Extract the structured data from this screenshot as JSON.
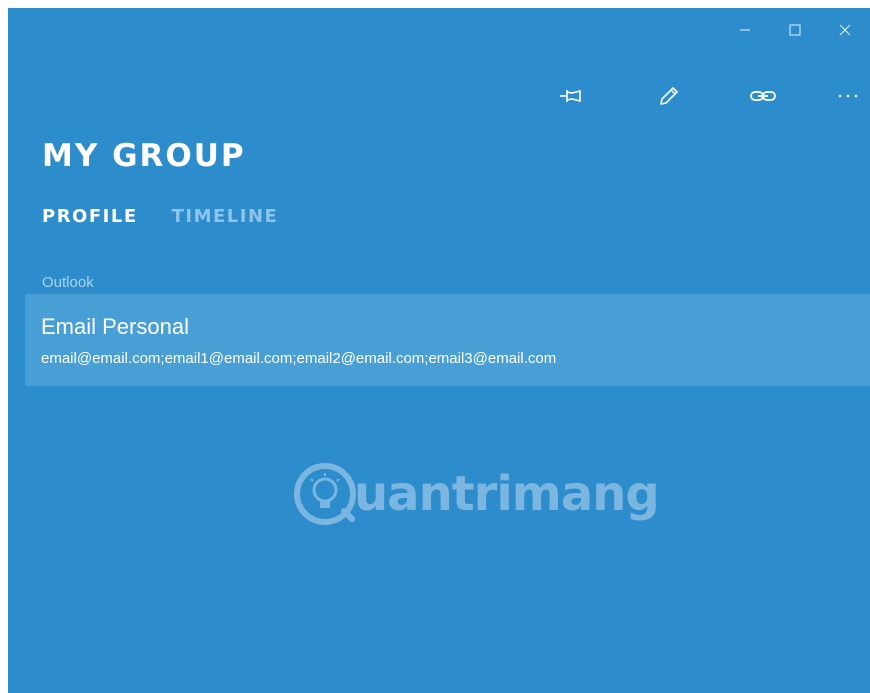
{
  "window": {
    "controls": {
      "minimize": "minimize-icon",
      "maximize": "maximize-icon",
      "close": "close-icon"
    }
  },
  "toolbar": {
    "icons": [
      "pin-icon",
      "edit-pencil-icon",
      "link-icon",
      "more-icon"
    ]
  },
  "page": {
    "title": "MY GROUP"
  },
  "tabs": [
    {
      "label": "PROFILE",
      "active": true
    },
    {
      "label": "TIMELINE",
      "active": false
    }
  ],
  "section": {
    "label": "Outlook",
    "item": {
      "title": "Email Personal",
      "subtitle": "email@email.com;email1@email.com;email2@email.com;email3@email.com"
    }
  },
  "watermark": {
    "text": "uantrimang"
  },
  "colors": {
    "background": "#2d8ccb",
    "item_bg": "#489fd5",
    "inactive_tab": "#8cc4ea",
    "section_label": "#a9d2ef"
  }
}
